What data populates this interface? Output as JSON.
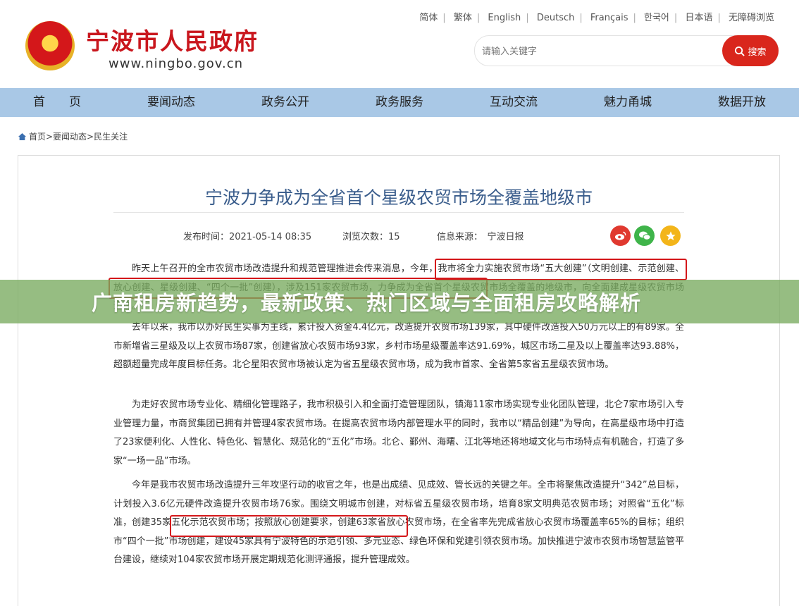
{
  "header": {
    "languages": [
      "简体",
      "繁体",
      "English",
      "Deutsch",
      "Français",
      "한국어",
      "日本语",
      "无障碍浏览"
    ],
    "site_title": "宁波市人民政府",
    "site_url": "www.ningbo.gov.cn",
    "search_placeholder": "请输入关键字",
    "search_button": "搜索"
  },
  "nav": [
    "首　　页",
    "要闻动态",
    "政务公开",
    "政务服务",
    "互动交流",
    "魅力甬城",
    "数据开放"
  ],
  "breadcrumb": "首页>要闻动态>民生关注",
  "article": {
    "title": "宁波力争成为全省首个星级农贸市场全覆盖地级市",
    "publish_time": "发布时间：2021-05-14 08:35",
    "views": "浏览次数：15",
    "source": "信息来源：　宁波日报",
    "paragraphs": [
      "昨天上午召开的全市农贸市场改造提升和规范管理推进会传来消息，今年，我市将全力实施农贸市场“五大创建”（文明创建、示范创建、放心创建、星级创建、“四个一批”创建），涉及151家农贸市场，力争成为全省首个星级农贸市场全覆盖的地级市，向全面建成星级农贸市场迈进。",
      "去年以来，我市以办好民生实事为主线，累计投入资金4.4亿元，改造提升农贸市场139家，其中硬件改造投入50万元以上的有89家。全市新增省三星级及以上农贸市场87家，创建省放心农贸市场93家，乡村市场星级覆盖率达91.69%，城区市场二星及以上覆盖率达93.88%，超额超量完成年度目标任务。北仑星阳农贸市场被认定为省五星级农贸市场，成为我市首家、全省第5家省五星级农贸市场。",
      "为走好农贸市场专业化、精细化管理路子，我市积极引入和全面打造管理团队，镇海11家市场实现专业化团队管理，北仑7家市场引入专业管理力量，市商贸集团已拥有并管理4家农贸市场。在提高农贸市场内部管理水平的同时，我市以“精品创建”为导向，在高星级市场中打造了23家便利化、人性化、特色化、智慧化、规范化的“五化”市场。北仑、鄞州、海曙、江北等地还将地域文化与市场特点有机融合，打造了多家“一场一品”市场。",
      "今年是我市农贸市场改造提升三年攻坚行动的收官之年，也是出成绩、见成效、管长远的关键之年。全市将聚焦改造提升“342”总目标，计划投入3.6亿元硬件改造提升农贸市场76家。围绕文明城市创建，对标省五星级农贸市场，培育8家文明典范农贸市场；对照省“五化”标准，创建35家五化示范农贸市场；按照放心创建要求，创建63家省放心农贸市场，在全省率先完成省放心农贸市场覆盖率65%的目标；组织市“四个一批”市场创建，建设45家具有宁波特色的示范引领、多元业态、绿色环保和党建引领农贸市场。加快推进宁波市农贸市场智慧监管平台建设，继续对104家农贸市场开展定期规范化测评通报，提升管理成效。"
    ]
  },
  "overlay_banner": "广南租房新趋势，最新政策、热门区域与全面租房攻略解析",
  "colors": {
    "brand_red": "#c9161d",
    "nav_blue": "#a9c8e6",
    "title_blue": "#3a5d8c",
    "banner_green": "#78aa5f"
  },
  "icons": [
    "national-emblem-icon",
    "search-icon",
    "home-icon",
    "weibo-icon",
    "wechat-icon",
    "favorite-star-icon"
  ]
}
